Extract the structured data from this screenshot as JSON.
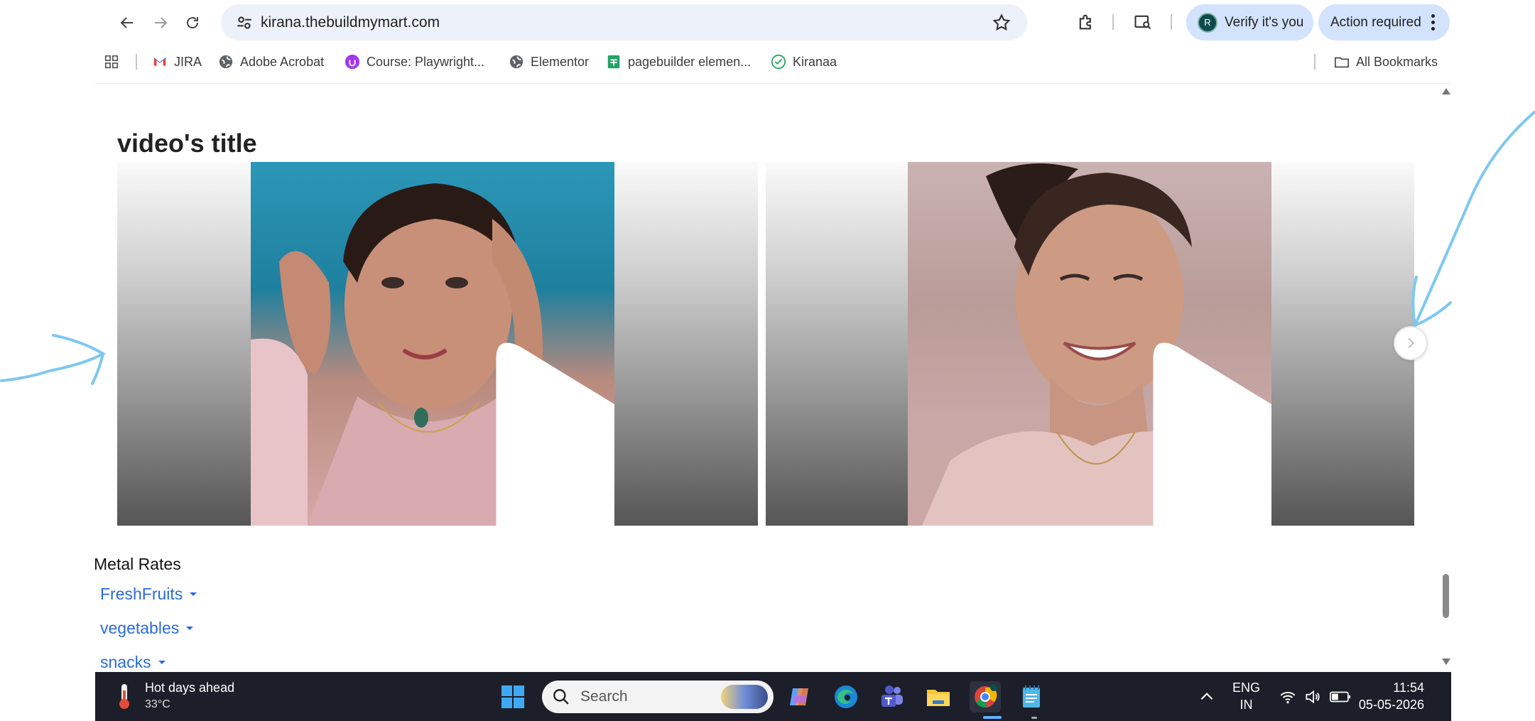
{
  "browser": {
    "url": "kirana.thebuildmymart.com",
    "verify_label": "Verify it's you",
    "verify_avatar": "R",
    "action_label": "Action required"
  },
  "bookmarks": [
    {
      "label": "JIRA",
      "icon": "gmail-icon"
    },
    {
      "label": "Adobe Acrobat",
      "icon": "globe-icon"
    },
    {
      "label": "Course: Playwright...",
      "icon": "udemy-icon"
    },
    {
      "label": "Elementor",
      "icon": "globe-icon"
    },
    {
      "label": "pagebuilder elemen...",
      "icon": "sheets-icon"
    },
    {
      "label": "Kiranaa",
      "icon": "check-icon"
    }
  ],
  "all_bookmarks_label": "All Bookmarks",
  "page": {
    "video_section_title": "video's title",
    "metal_rates": "Metal Rates",
    "menu": [
      "FreshFruits",
      "vegetables",
      "snacks"
    ]
  },
  "taskbar": {
    "weather_title": "Hot days ahead",
    "weather_temp": "33°C",
    "search_placeholder": "Search",
    "lang_top": "ENG",
    "lang_bottom": "IN",
    "time": "11:54",
    "date": "05-05-2026"
  },
  "colors": {
    "annotation": "#7ec8f0",
    "link": "#2a6bd8",
    "pill": "#d3e3fd",
    "taskbar": "#1c1f2a"
  }
}
